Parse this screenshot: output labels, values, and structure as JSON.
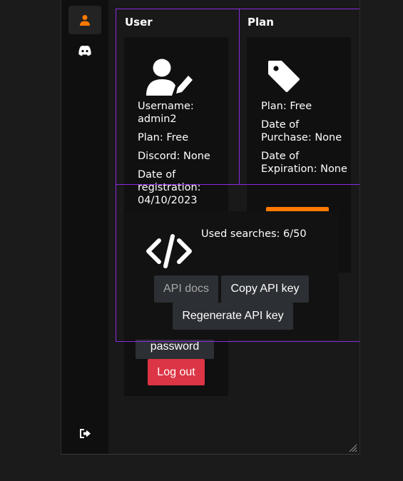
{
  "sidebar": {
    "items": [
      {
        "icon": "user-icon",
        "active": true
      },
      {
        "icon": "discord-icon",
        "active": false
      }
    ],
    "logout_icon": "logout-icon"
  },
  "user_section": {
    "title": "User",
    "username": "Username: admin2",
    "plan": "Plan: Free",
    "discord": "Discord: None",
    "registration": "Date of registration: 04/10/2023",
    "change_password_label": "password",
    "logout_label": "Log out"
  },
  "plan_section": {
    "title": "Plan",
    "plan": "Plan: Free",
    "purchase": "Date of Purchase: None",
    "expiration": "Date of Expiration: None"
  },
  "api_section": {
    "used_searches": "Used searches: 6/50",
    "api_docs_label": "API docs",
    "copy_key_label": "Copy API key",
    "regenerate_label": "Regenerate API key"
  },
  "colors": {
    "accent": "#ff7a00",
    "danger": "#dc3545",
    "outline": "#8a2be2",
    "button": "#2c2f33"
  }
}
